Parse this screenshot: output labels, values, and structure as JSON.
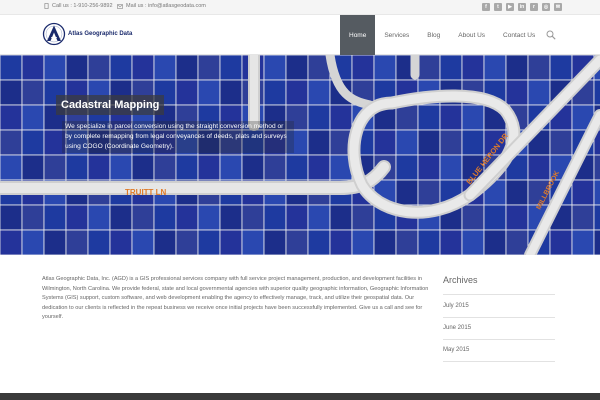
{
  "topbar": {
    "phone": "Call us : 1-910-256-9892",
    "email": "Mail us : info@atlasgeodata.com",
    "socials": [
      {
        "name": "facebook-icon",
        "glyph": "f"
      },
      {
        "name": "twitter-icon",
        "glyph": "t"
      },
      {
        "name": "youtube-icon",
        "glyph": "▶"
      },
      {
        "name": "linkedin-icon",
        "glyph": "in"
      },
      {
        "name": "rss-icon",
        "glyph": "r"
      },
      {
        "name": "instagram-icon",
        "glyph": "◎"
      },
      {
        "name": "email-icon",
        "glyph": "✉"
      }
    ]
  },
  "header": {
    "logo_text": "Atlas Geographic Data",
    "nav": [
      "Home",
      "Services",
      "Blog",
      "About Us",
      "Contact Us"
    ],
    "active_nav": "Home"
  },
  "hero": {
    "title": "Cadastral Mapping",
    "text": "We specialize in parcel conversion using the straight conversion method or by complete remapping from legal conveyances of deeds, plats and surveys using COGO (Coordinate Geometry).",
    "street_labels": [
      "TRUITT LN",
      "BLUE HERON DR",
      "MILLBROOK"
    ]
  },
  "intro": {
    "text": "Atlas Geographic Data, Inc. (AGD) is a GIS professional services company with full service project management, production, and development facilities in Wilmington, North Carolina.  We provide federal, state and local governmental agencies with superior quality geographic information, Geographic Information Systems (GIS) support, custom software, and web development enabling the agency to effectively manage, track, and utilize their geospatial data.  Our dedication to our clients is reflected in the repeat business we receive once initial projects have been successfully implemented.  Give us a call and see for  yourself."
  },
  "archives": {
    "title": "Archives",
    "items": [
      "July 2015",
      "June 2015",
      "May 2015"
    ]
  },
  "colors": {
    "nav_active": "#555b61",
    "map_parcel": "#1e3aa0",
    "map_road": "#d9d9d9",
    "street_label": "#e07b28"
  }
}
